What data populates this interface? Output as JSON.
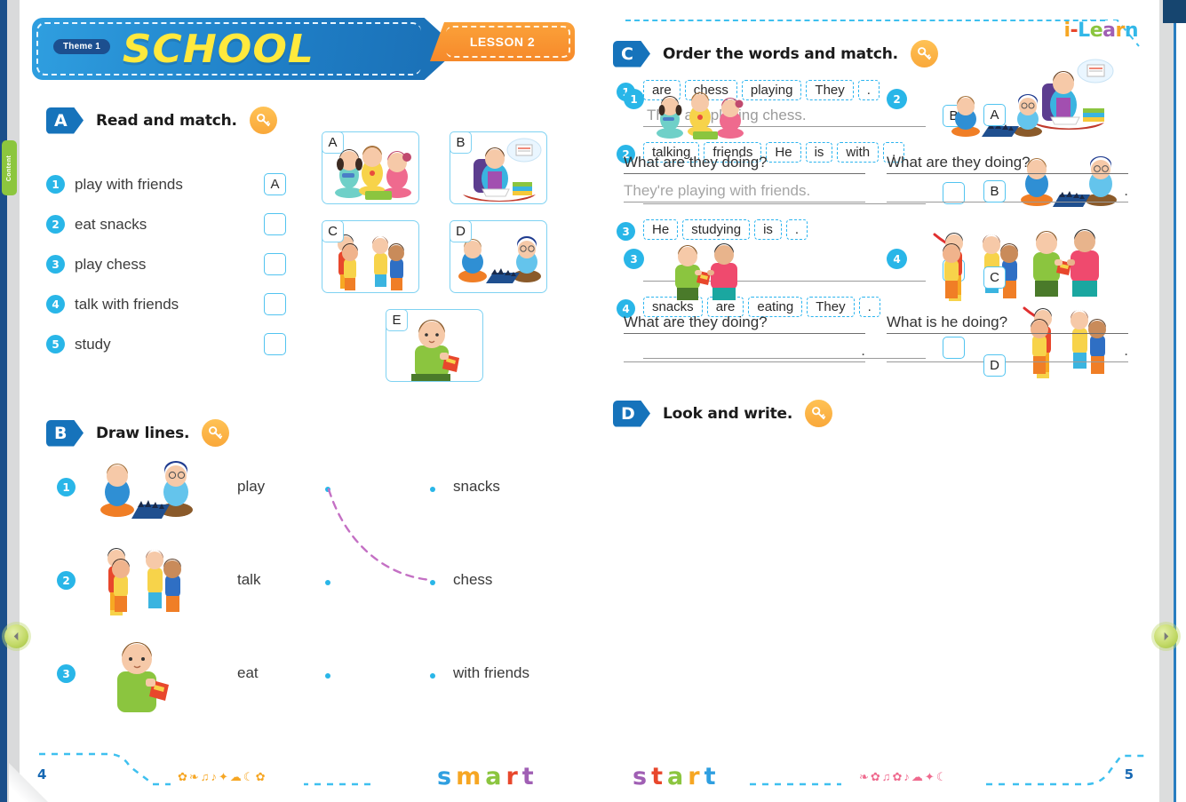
{
  "viewer": {
    "content_tab_label": "Content",
    "prev_icon": "triangle-left-icon",
    "next_icon": "triangle-right-icon"
  },
  "header": {
    "theme_label": "Theme 1",
    "title": "SCHOOL",
    "lesson_label": "LESSON 2"
  },
  "brand": {
    "logo_letters": [
      "i",
      "-",
      "L",
      "e",
      "a",
      "r",
      "n"
    ],
    "logo_text": "i-Learn"
  },
  "exercise_a": {
    "badge": "A",
    "title": "Read and match.",
    "key_icon": "key-icon",
    "items": [
      {
        "num": "1",
        "text": "play with friends",
        "answer": "A"
      },
      {
        "num": "2",
        "text": "eat snacks",
        "answer": ""
      },
      {
        "num": "3",
        "text": "play chess",
        "answer": ""
      },
      {
        "num": "4",
        "text": "talk with friends",
        "answer": ""
      },
      {
        "num": "5",
        "text": "study",
        "answer": ""
      }
    ],
    "pictures": [
      {
        "letter": "A",
        "alt": "three children playing with toys on the floor"
      },
      {
        "letter": "B",
        "alt": "boy reading a book with thought bubble"
      },
      {
        "letter": "C",
        "alt": "four children talking together"
      },
      {
        "letter": "D",
        "alt": "two boys playing chess on the floor"
      },
      {
        "letter": "E",
        "alt": "boy eating snacks from a bag"
      }
    ]
  },
  "exercise_b": {
    "badge": "B",
    "title": "Draw lines.",
    "key_icon": "key-icon",
    "rows": [
      {
        "num": "1",
        "left_word": "play",
        "right_word": "snacks",
        "alt": "two boys playing chess"
      },
      {
        "num": "2",
        "left_word": "talk",
        "right_word": "chess",
        "alt": "children talking"
      },
      {
        "num": "3",
        "left_word": "eat",
        "right_word": "with friends",
        "alt": "boy eating snacks"
      }
    ],
    "drawn_line": {
      "from": "play",
      "to": "chess"
    }
  },
  "exercise_c": {
    "badge": "C",
    "title": "Order the words and match.",
    "key_icon": "key-icon",
    "items": [
      {
        "num": "1",
        "tiles": [
          "are",
          "chess",
          "playing",
          "They",
          "."
        ],
        "answer": "They are playing chess.",
        "match": "B"
      },
      {
        "num": "2",
        "tiles": [
          "talking",
          "friends",
          "He",
          "is",
          "with",
          "."
        ],
        "answer": "",
        "match": ""
      },
      {
        "num": "3",
        "tiles": [
          "He",
          "studying",
          "is",
          "."
        ],
        "answer": "",
        "match": ""
      },
      {
        "num": "4",
        "tiles": [
          "snacks",
          "are",
          "eating",
          "They",
          "."
        ],
        "answer": "",
        "match": ""
      }
    ],
    "pictures": [
      {
        "letter": "A",
        "alt": "boy reading a book with thought bubble"
      },
      {
        "letter": "B",
        "alt": "two boys playing chess"
      },
      {
        "letter": "C",
        "alt": "two boys sharing a snack bag"
      },
      {
        "letter": "D",
        "alt": "children talking with red arrow"
      }
    ]
  },
  "exercise_d": {
    "badge": "D",
    "title": "Look and write.",
    "key_icon": "key-icon",
    "items": [
      {
        "num": "1",
        "question": "What are they doing?",
        "answer": "They're playing with friends.",
        "end_dot": "",
        "alt": "three children playing"
      },
      {
        "num": "2",
        "question": "What are they doing?",
        "answer": "",
        "end_dot": ".",
        "alt": "two boys playing chess"
      },
      {
        "num": "3",
        "question": "What are they doing?",
        "answer": "",
        "end_dot": ".",
        "alt": "two boys sharing a snack"
      },
      {
        "num": "4",
        "question": "What is he doing?",
        "answer": "",
        "end_dot": ".",
        "alt": "children talking with red arrow"
      }
    ]
  },
  "footer": {
    "left_page_number": "4",
    "right_page_number": "5",
    "smart_letters": [
      "s",
      "m",
      "a",
      "r",
      "t"
    ],
    "start_letters": [
      "s",
      "t",
      "a",
      "r",
      "t"
    ],
    "smart_text": "smart",
    "start_text": "start",
    "doodles_left": "✿❧♫♪✦☁☾✿",
    "doodles_right": "❧✿♫✿♪☁✦☾"
  },
  "colors": {
    "banner_blue": "#1f7fc7",
    "title_yellow": "#ffe93d",
    "lesson_orange": "#f6892a",
    "badge_blue": "#1673bb",
    "bullet_cyan": "#29b6e8",
    "key_orange": "#f9a83a",
    "dash_blue": "#3ec0ef",
    "green_tab": "#8cc63e"
  }
}
